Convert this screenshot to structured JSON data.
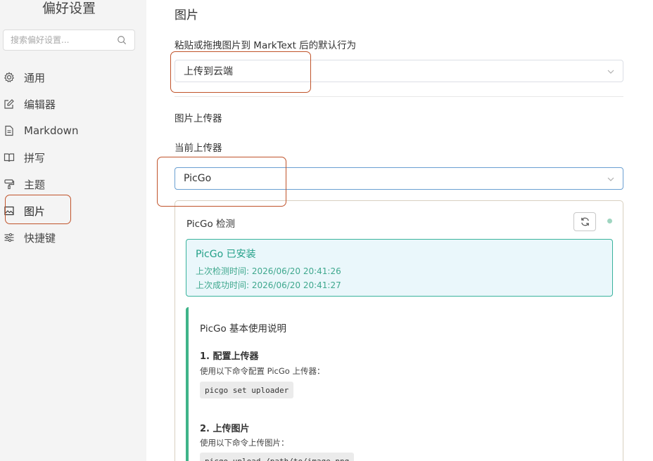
{
  "sidebar": {
    "title": "偏好设置",
    "search_placeholder": "搜索偏好设置...",
    "items": [
      {
        "label": "通用",
        "icon": "gear-icon"
      },
      {
        "label": "编辑器",
        "icon": "edit-icon"
      },
      {
        "label": "Markdown",
        "icon": "document-icon"
      },
      {
        "label": "拼写",
        "icon": "book-icon"
      },
      {
        "label": "主题",
        "icon": "paint-roller-icon"
      },
      {
        "label": "图片",
        "icon": "image-icon",
        "active": true
      },
      {
        "label": "快捷键",
        "icon": "sliders-icon"
      }
    ]
  },
  "main": {
    "title": "图片",
    "paste_behavior_label": "粘贴或拖拽图片到 MarkText 后的默认行为",
    "paste_behavior_value": "上传到云端",
    "uploader_section": "图片上传器",
    "current_uploader_label": "当前上传器",
    "current_uploader_value": "PicGo",
    "picgo": {
      "title": "PicGo 检测",
      "installed_title": "PicGo 已安装",
      "last_check": "上次检测时间: 2026/06/20 20:41:26",
      "last_success": "上次成功时间: 2026/06/20 20:41:27",
      "guide_title": "PicGo 基本使用说明",
      "step1_title": "1. 配置上传器",
      "step1_text": "使用以下命令配置 PicGo 上传器：",
      "step1_code": "picgo set uploader",
      "step2_title": "2. 上传图片",
      "step2_text": "使用以下命令上传图片：",
      "step2_code": "picgo upload /path/to/image.png"
    }
  },
  "colors": {
    "annotation": "#c0532a",
    "success": "#23a088",
    "accent_border": "#3fb489"
  }
}
